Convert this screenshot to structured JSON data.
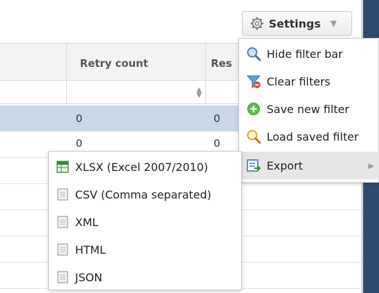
{
  "settings": {
    "label": "Settings",
    "icon": "gear-icon"
  },
  "grid": {
    "columns": [
      {
        "label": ""
      },
      {
        "label": "Retry count"
      },
      {
        "label": "Res"
      }
    ],
    "rows": [
      {
        "retry": "0",
        "res": "0",
        "selected": true
      },
      {
        "retry": "0",
        "res": "0",
        "selected": false
      }
    ]
  },
  "settings_menu": {
    "items": [
      {
        "label": "Hide filter bar",
        "icon": "magnifier-minus-icon"
      },
      {
        "label": "Clear filters",
        "icon": "funnel-clear-icon"
      },
      {
        "label": "Save new filter",
        "icon": "add-circle-icon"
      },
      {
        "label": "Load saved filter",
        "icon": "magnifier-icon"
      },
      {
        "label": "Export",
        "icon": "export-icon"
      }
    ]
  },
  "export_menu": {
    "items": [
      {
        "label": "XLSX (Excel 2007/2010)",
        "icon": "excel-file-icon"
      },
      {
        "label": "CSV (Comma separated)",
        "icon": "document-icon"
      },
      {
        "label": "XML",
        "icon": "document-icon"
      },
      {
        "label": "HTML",
        "icon": "document-icon"
      },
      {
        "label": "JSON",
        "icon": "document-icon"
      }
    ]
  },
  "colors": {
    "selected_row": "#c9d8e7",
    "menu_hover": "#e6e6e6",
    "strip": "#2f4a6e"
  }
}
